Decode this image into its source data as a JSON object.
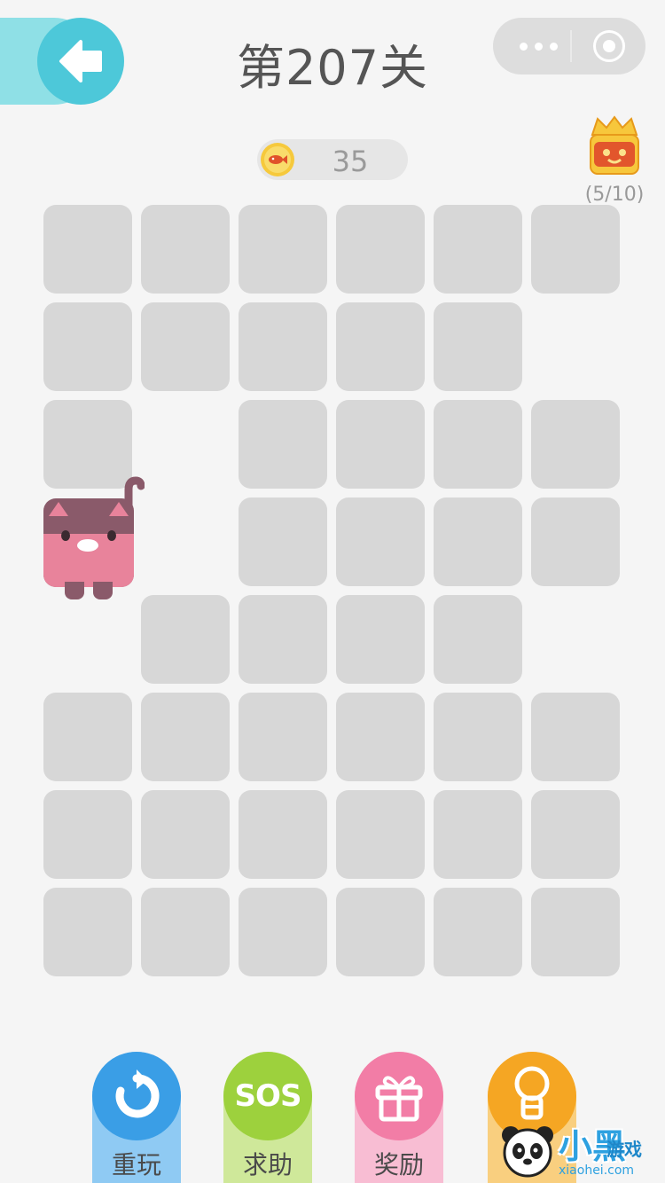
{
  "header": {
    "title": "第207关"
  },
  "coins": {
    "value": "35"
  },
  "chest": {
    "progress": "(5/10)"
  },
  "board": {
    "tiles": [
      [
        1,
        1,
        1,
        1,
        1,
        1
      ],
      [
        1,
        1,
        1,
        1,
        1,
        0
      ],
      [
        1,
        0,
        1,
        1,
        1,
        1
      ],
      [
        0,
        0,
        1,
        1,
        1,
        1
      ],
      [
        0,
        1,
        1,
        1,
        1,
        0
      ],
      [
        1,
        1,
        1,
        1,
        1,
        1
      ],
      [
        1,
        1,
        1,
        1,
        1,
        1
      ],
      [
        1,
        1,
        1,
        1,
        1,
        1
      ]
    ],
    "cat_cell": [
      3,
      0
    ]
  },
  "actions": {
    "replay_label": "重玩",
    "sos_label": "求助",
    "sos_text": "SOS",
    "reward_label": "奖励",
    "hint_label": ""
  },
  "colors": {
    "replay": "#3a9ee6",
    "sos": "#9dd13d",
    "reward": "#f27da6",
    "hint": "#f5a623",
    "tile": "#d7d7d7",
    "cat_body": "#8a5a6a"
  },
  "icons": {
    "back": "arrow-left-icon",
    "more": "more-dots-icon",
    "close": "target-close-icon",
    "coin": "fish-coin-icon",
    "chest": "treasure-chest-icon",
    "replay": "replay-icon",
    "reward": "gift-icon",
    "hint": "lightbulb-icon"
  },
  "watermark": {
    "brand": "小黑",
    "brand_sub": "游戏",
    "url": "xiaohei.com"
  }
}
